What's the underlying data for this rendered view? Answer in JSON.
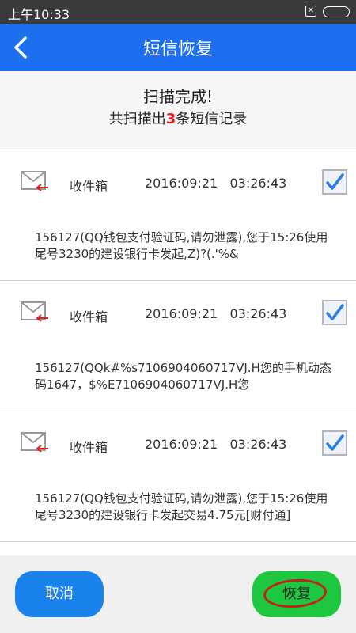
{
  "status_bar": {
    "time": "上午10:33",
    "sim_glyph": "✕"
  },
  "app_bar": {
    "title": "短信恢复"
  },
  "summary": {
    "title": "扫描完成!",
    "prefix": "共扫描出",
    "count": "3",
    "suffix": "条短信记录",
    "count_color": "#e0211b"
  },
  "messages": [
    {
      "folder": "收件箱",
      "datetime": "2016:09:21   03:26:43",
      "checked": true,
      "body": "156127(QQ钱包支付验证码,请勿泄露),您于15:26使用尾号3230的建设银行卡发起,Z)?(.'%&"
    },
    {
      "folder": "收件箱",
      "datetime": "2016:09:21   03:26:43",
      "checked": true,
      "body": "156127(QQk#%s7106904060717VJ.H您的手机动态码1647，$%E7106904060717VJ.H您"
    },
    {
      "folder": "收件箱",
      "datetime": "2016:09:21   03:26:43",
      "checked": true,
      "body": "156127(QQ钱包支付验证码,请勿泄露),您于15:26使用尾号3230的建设银行卡发起交易4.75元[财付通]"
    }
  ],
  "footer": {
    "cancel_label": "取消",
    "restore_label": "恢复"
  },
  "colors": {
    "app_bar": "#1e6ff0",
    "cancel": "#1a82ec",
    "restore": "#1ec740",
    "annotation_ring": "#c4201a"
  }
}
